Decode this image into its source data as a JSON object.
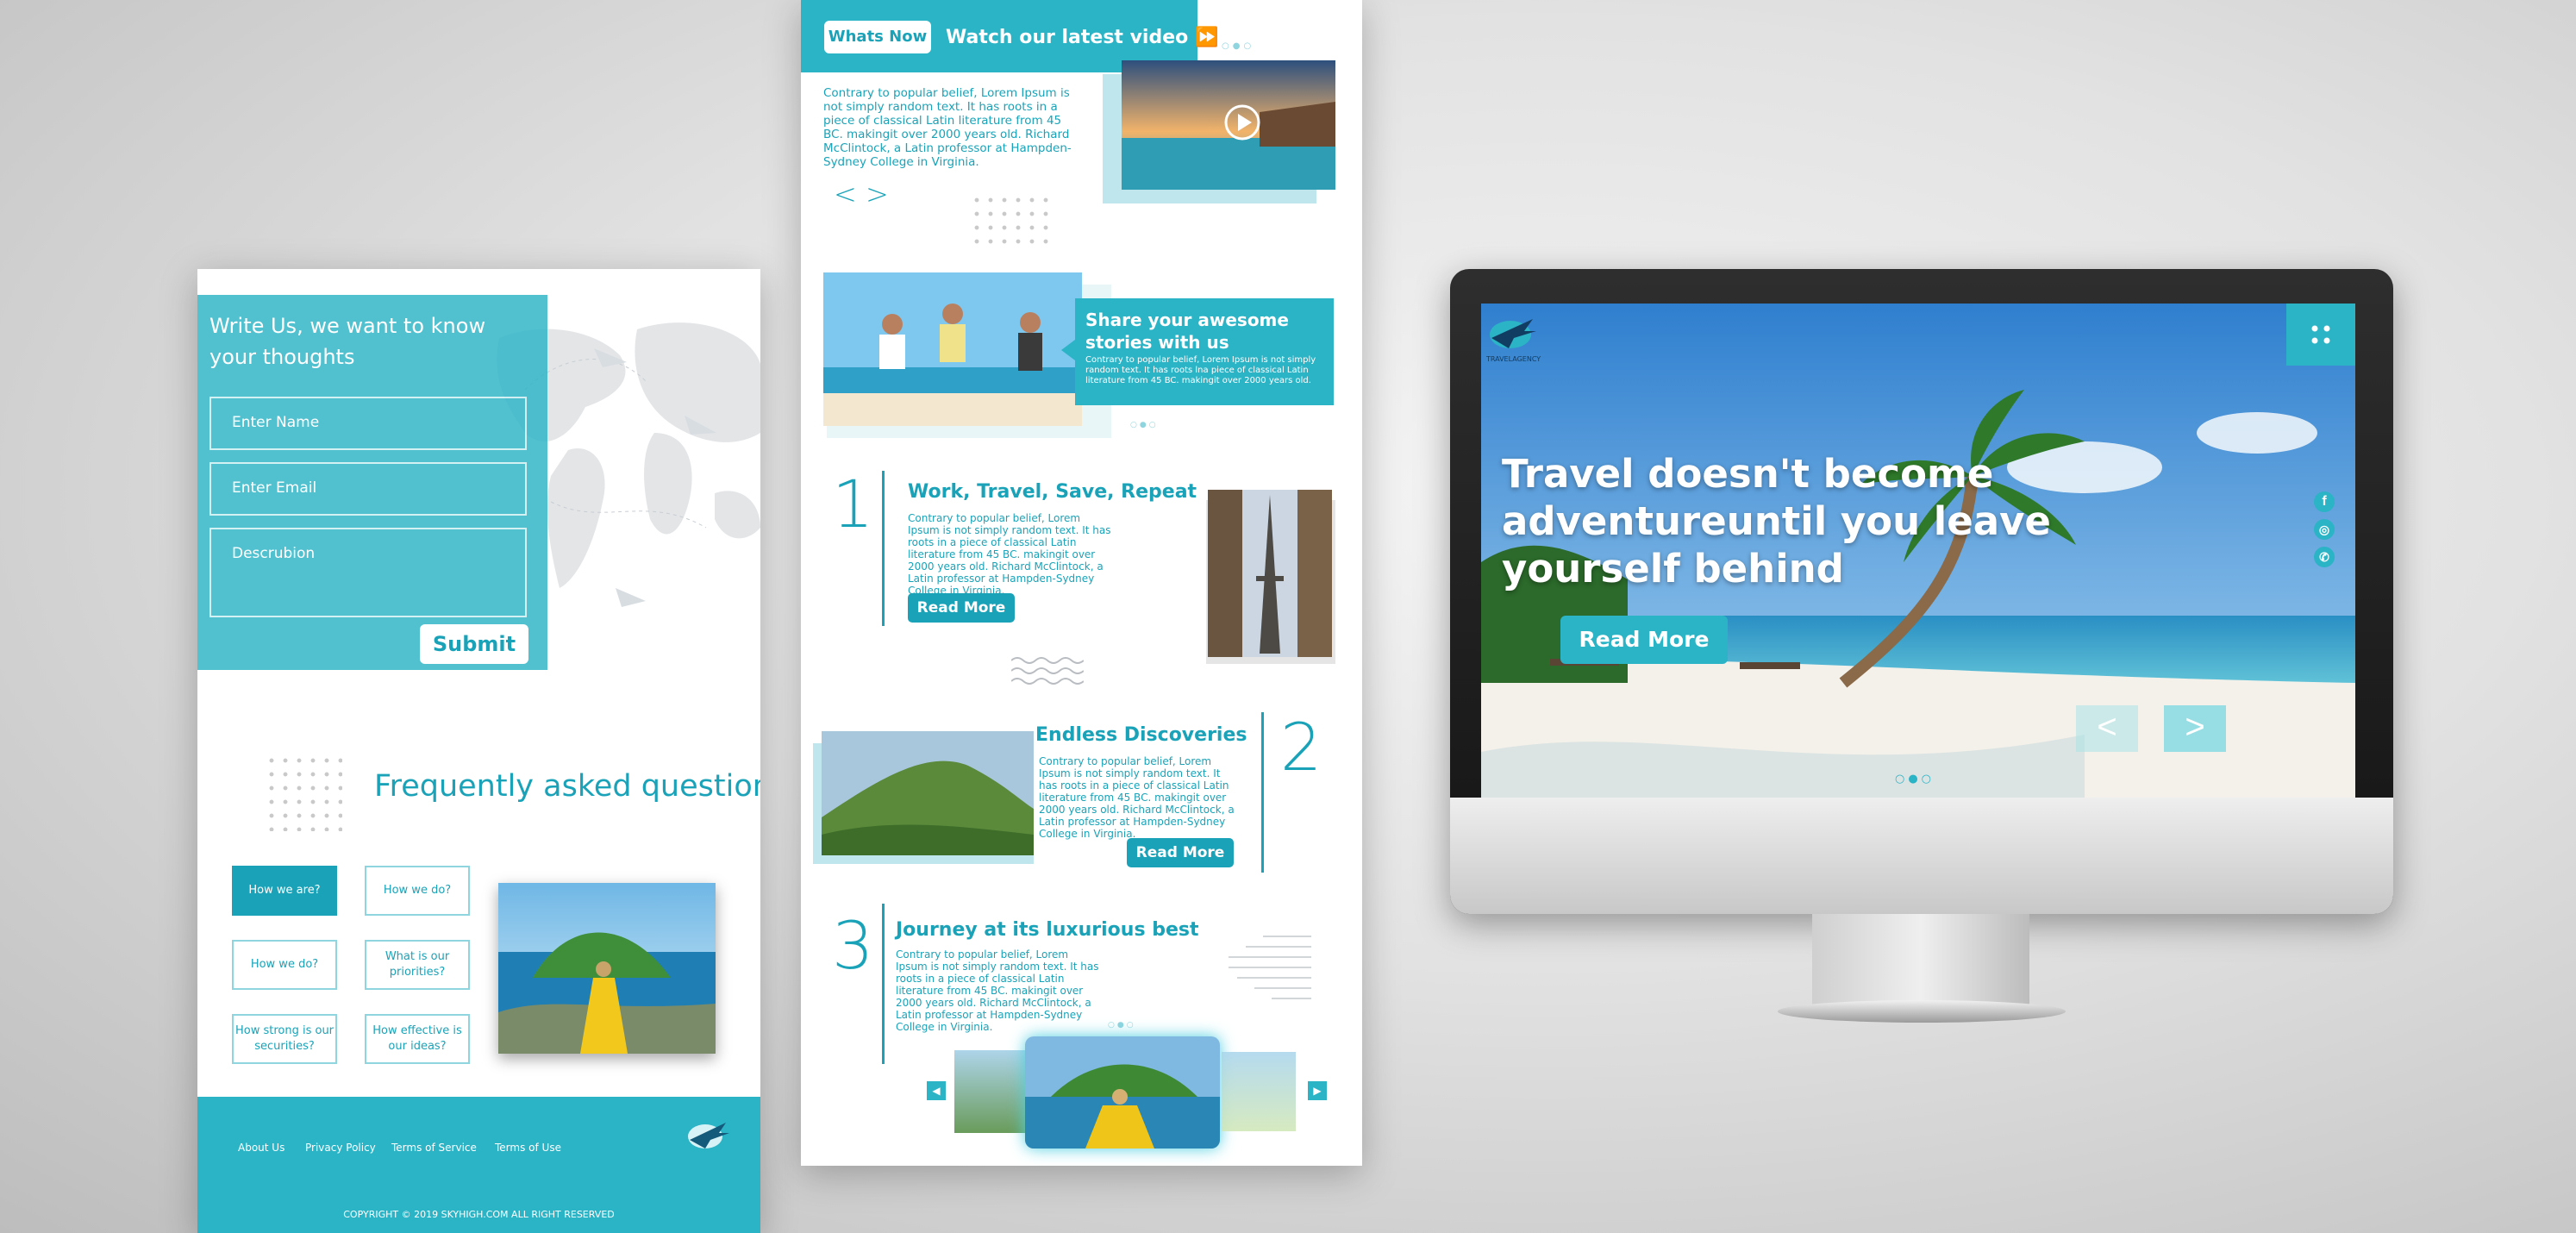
{
  "form_panel": {
    "heading": "Write Us, we want to know your thoughts",
    "name_placeholder": "Enter Name",
    "email_placeholder": "Enter Email",
    "description_placeholder": "Descrubion",
    "submit_label": "Submit"
  },
  "faq": {
    "title": "Frequently asked question",
    "items": [
      "How we are?",
      "How we do?",
      "How we do?",
      "What is our priorities?",
      "How strong is our securities?",
      "How effective is our ideas?"
    ]
  },
  "footer": {
    "links": [
      "About Us",
      "Privacy Policy",
      "Terms of Service",
      "Terms of Use"
    ],
    "copyright": "COPYRIGHT © 2019 SKYHIGH.COM ALL RIGHT RESERVED"
  },
  "mid_panel": {
    "whats_now": "Whats Now",
    "watch_video": "Watch our latest video",
    "intro_text": "Contrary to popular belief, Lorem Ipsum is not simply random text. It has roots in a piece of classical Latin literature from 45 BC. makingit over 2000 years old. Richard McClintock, a Latin professor at Hampden-Sydney College in Virginia.",
    "share_title": "Share your awesome stories with us",
    "share_text": "Contrary to popular belief, Lorem Ipsum is not simply random text. It has roots lna piece of classical Latin literature from 45 BC. makingit over 2000 years old.",
    "sections": [
      {
        "number": "1",
        "title": "Work, Travel, Save, Repeat",
        "text": "Contrary to popular belief, Lorem Ipsum is not simply random text. It has roots in a piece of classical Latin literature from 45 BC. makingit over 2000 years old. Richard McClintock, a Latin professor at Hampden-Sydney College in Virginia.",
        "button": "Read More"
      },
      {
        "number": "2",
        "title": "Endless Discoveries",
        "text": "Contrary to popular belief, Lorem Ipsum is not simply random text. It has roots in a piece of classical Latin literature from 45 BC. makingit over 2000 years old. Richard McClintock, a Latin professor at Hampden-Sydney College in Virginia.",
        "button": "Read More"
      },
      {
        "number": "3",
        "title": "Journey at its luxurious best",
        "text": "Contrary to popular belief, Lorem Ipsum is not simply random text. It has roots in a piece of classical Latin literature from 45 BC. makingit over 2000 years old. Richard McClintock, a Latin professor at Hampden-Sydney College in Virginia."
      }
    ]
  },
  "monitor": {
    "headline": "Travel doesn't become adventureuntil you leave yourself behind",
    "read_more": "Read More",
    "logo_text": "TRAVELAGENCY",
    "social_icons": [
      "facebook-icon",
      "instagram-icon",
      "whatsapp-icon"
    ]
  },
  "colors": {
    "accent": "#2bb3c6",
    "accent_dark": "#1aa3b8"
  }
}
